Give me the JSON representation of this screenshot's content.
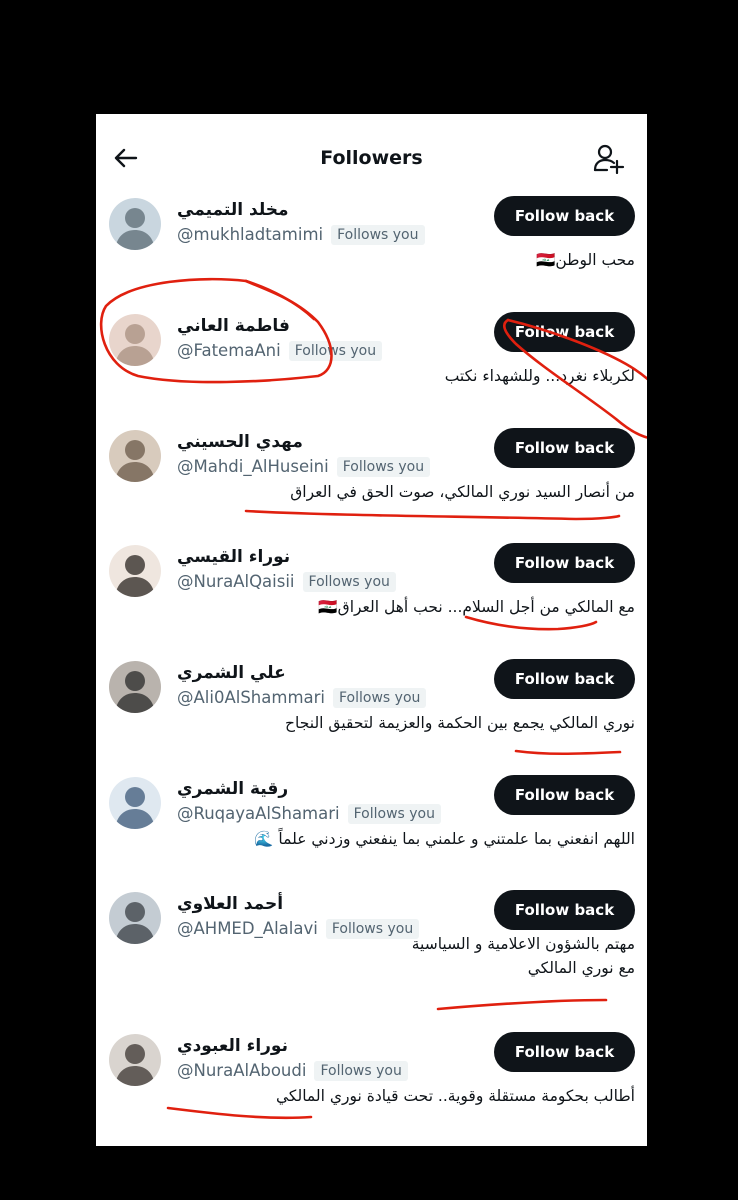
{
  "header": {
    "title": "Followers",
    "back_icon": "arrow-left-icon",
    "add_icon": "add-user-icon"
  },
  "followers": [
    {
      "name": "مخلد التميمي",
      "handle": "@mukhladtamimi",
      "follows_you": "Follows you",
      "button": "Follow back",
      "bio": [
        "محب الوطن🇮🇶"
      ]
    },
    {
      "name": "فاطمة العاني",
      "handle": "@FatemaAni",
      "follows_you": "Follows you",
      "button": "Follow back",
      "bio": [
        "لكربلاء نغرد... وللشهداء نكتب"
      ]
    },
    {
      "name": "مهدي الحسيني",
      "handle": "@Mahdi_AlHuseini",
      "follows_you": "Follows you",
      "button": "Follow back",
      "bio": [
        "من أنصار السيد نوري المالكي، صوت الحق في العراق"
      ]
    },
    {
      "name": "نوراء القيسي",
      "handle": "@NuraAlQaisii",
      "follows_you": "Follows you",
      "button": "Follow back",
      "bio": [
        "مع المالكي من أجل السلام... نحب أهل العراق🇮🇶"
      ]
    },
    {
      "name": "علي الشمري",
      "handle": "@Ali0AlShammari",
      "follows_you": "Follows you",
      "button": "Follow back",
      "bio": [
        "نوري المالكي يجمع بين الحكمة والعزيمة لتحقيق النجاح"
      ]
    },
    {
      "name": "رقية الشمري",
      "handle": "@RuqayaAlShamari",
      "follows_you": "Follows you",
      "button": "Follow back",
      "bio": [
        "اللهم انفعني بما علمتني و علمني بما ينفعني وزدني علماً 🌊"
      ]
    },
    {
      "name": "أحمد العلاوي",
      "handle": "@AHMED_Alalavi",
      "follows_you": "Follows you",
      "button": "Follow back",
      "bio": [
        "مهتم بالشؤون الاعلامية و السياسية",
        "مع نوري المالكي"
      ]
    },
    {
      "name": "نوراء العبودي",
      "handle": "@NuraAlAboudi",
      "follows_you": "Follows you",
      "button": "Follow back",
      "bio": [
        "أطالب بحكومة مستقلة وقوية.. تحت قيادة نوري المالكي"
      ]
    }
  ],
  "colors": {
    "button_bg": "#0f1419",
    "secondary_text": "#536471",
    "annotation": "#e0200f"
  }
}
